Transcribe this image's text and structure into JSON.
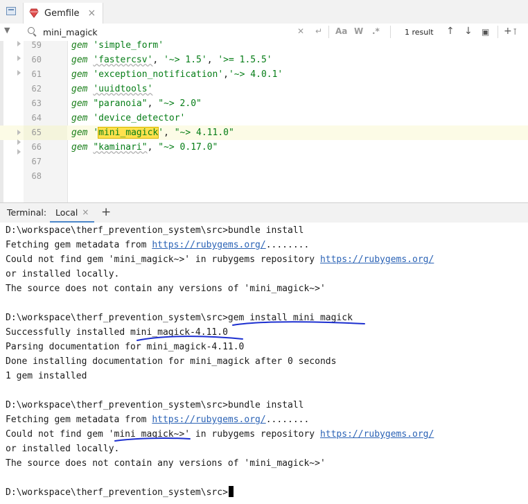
{
  "editor_tab": {
    "label": "Gemfile",
    "close": "×"
  },
  "search": {
    "query": "mini_magick",
    "result_count": "1 result",
    "match_case": "Aa",
    "words": "W",
    "regex": ".*"
  },
  "editor": {
    "lines": [
      {
        "num": "59",
        "parts": [
          {
            "t": "gem",
            "c": "kw"
          },
          {
            "t": " "
          },
          {
            "t": "'simple_form'",
            "c": "str"
          }
        ]
      },
      {
        "num": "60",
        "parts": [
          {
            "t": "gem",
            "c": "kw"
          },
          {
            "t": " "
          },
          {
            "t": "'fastercsv'",
            "c": "str wavy"
          },
          {
            "t": ", "
          },
          {
            "t": "'~> 1.5'",
            "c": "str"
          },
          {
            "t": ", "
          },
          {
            "t": "'>= 1.5.5'",
            "c": "str"
          }
        ]
      },
      {
        "num": "61",
        "parts": [
          {
            "t": "gem",
            "c": "kw"
          },
          {
            "t": " "
          },
          {
            "t": "'exception_notification'",
            "c": "str"
          },
          {
            "t": ","
          },
          {
            "t": "'~> 4.0.1'",
            "c": "str"
          }
        ]
      },
      {
        "num": "62",
        "parts": [
          {
            "t": "gem",
            "c": "kw"
          },
          {
            "t": " "
          },
          {
            "t": "'uuidtools'",
            "c": "str wavy"
          }
        ]
      },
      {
        "num": "63",
        "parts": [
          {
            "t": "gem",
            "c": "kw"
          },
          {
            "t": " "
          },
          {
            "t": "\"paranoia\"",
            "c": "str"
          },
          {
            "t": ", "
          },
          {
            "t": "\"~> 2.0\"",
            "c": "str"
          }
        ]
      },
      {
        "num": "64",
        "parts": [
          {
            "t": "gem",
            "c": "kw"
          },
          {
            "t": " "
          },
          {
            "t": "'device_detector'",
            "c": "str"
          }
        ]
      },
      {
        "num": "65",
        "parts": [
          {
            "t": "gem",
            "c": "kw"
          },
          {
            "t": " "
          },
          {
            "t": "'",
            "c": "str"
          },
          {
            "t": "mini_magick",
            "c": "hit"
          },
          {
            "t": "'",
            "c": "str"
          },
          {
            "t": ", "
          },
          {
            "t": "\"~> 4.11.0\"",
            "c": "str"
          }
        ]
      },
      {
        "num": "66",
        "parts": [
          {
            "t": "gem",
            "c": "kw"
          },
          {
            "t": " "
          },
          {
            "t": "\"kaminari\"",
            "c": "str wavy"
          },
          {
            "t": ", "
          },
          {
            "t": "\"~> 0.17.0\"",
            "c": "str"
          }
        ]
      },
      {
        "num": "67",
        "parts": []
      },
      {
        "num": "68",
        "parts": []
      }
    ]
  },
  "terminal_tabs": {
    "title": "Terminal:",
    "local": "Local",
    "close": "×",
    "new_tab": "+"
  },
  "terminal": {
    "lines": [
      [
        {
          "t": "D:\\workspace\\therf_prevention_system\\src>bundle install"
        }
      ],
      [
        {
          "t": "Fetching gem metadata from "
        },
        {
          "t": "https://rubygems.org/",
          "link": true
        },
        {
          "t": "........"
        }
      ],
      [
        {
          "t": "Could not find gem 'mini_magick~>' in rubygems repository "
        },
        {
          "t": "https://rubygems.org/",
          "link": true
        }
      ],
      [
        {
          "t": "or installed locally."
        }
      ],
      [
        {
          "t": "The source does not contain any versions of 'mini_magick~>'"
        }
      ],
      [],
      [
        {
          "t": "D:\\workspace\\therf_prevention_system\\src>gem install mini_magick"
        }
      ],
      [
        {
          "t": "Successfully installed mini_magick-4.11.0"
        }
      ],
      [
        {
          "t": "Parsing documentation for mini_magick-4.11.0"
        }
      ],
      [
        {
          "t": "Done installing documentation for mini_magick after 0 seconds"
        }
      ],
      [
        {
          "t": "1 gem installed"
        }
      ],
      [],
      [
        {
          "t": "D:\\workspace\\therf_prevention_system\\src>bundle install"
        }
      ],
      [
        {
          "t": "Fetching gem metadata from "
        },
        {
          "t": "https://rubygems.org/",
          "link": true
        },
        {
          "t": "........"
        }
      ],
      [
        {
          "t": "Could not find gem 'mini_magick~>' in rubygems repository "
        },
        {
          "t": "https://rubygems.org/",
          "link": true
        }
      ],
      [
        {
          "t": "or installed locally."
        }
      ],
      [
        {
          "t": "The source does not contain any versions of 'mini_magick~>'"
        }
      ],
      [],
      [
        {
          "t": "D:\\workspace\\therf_prevention_system\\src>"
        }
      ]
    ]
  },
  "colors": {
    "highlight": "#ffe14d",
    "link": "#2a62b5",
    "annotation_pen": "#1c2fd0",
    "string": "#067d17"
  }
}
